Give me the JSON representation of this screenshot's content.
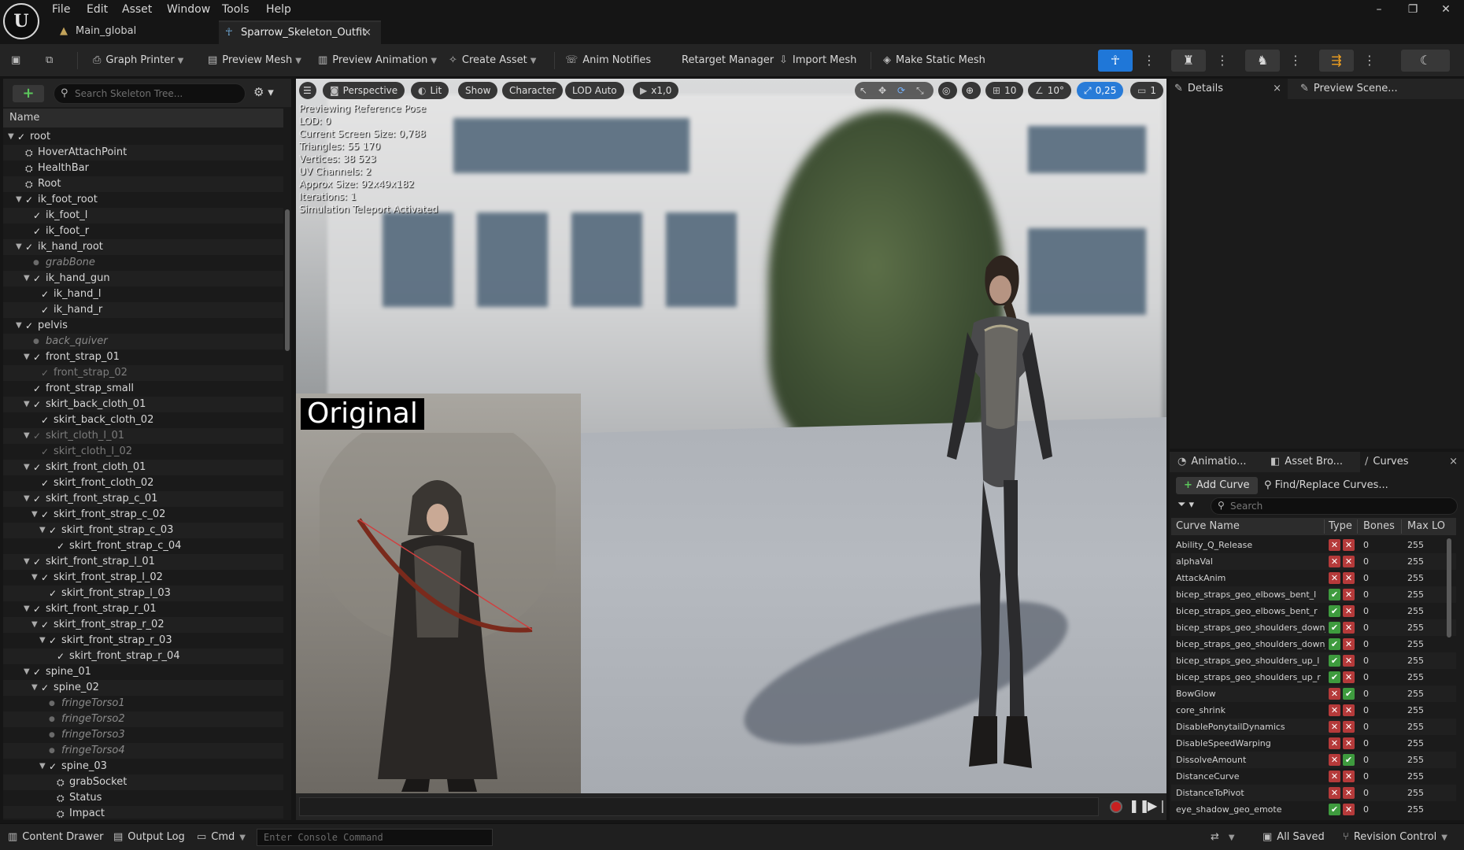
{
  "menu": [
    "File",
    "Edit",
    "Asset",
    "Window",
    "Tools",
    "Help"
  ],
  "tabs": [
    {
      "label": "Main_global"
    },
    {
      "label": "Sparrow_Skeleton_Outfit",
      "close": "×"
    }
  ],
  "window_controls": {
    "minimize": "–",
    "restore": "❐",
    "close": "✕"
  },
  "toolbar": {
    "graph_printer": "Graph Printer",
    "preview_mesh": "Preview Mesh",
    "preview_animation": "Preview Animation",
    "create_asset": "Create Asset",
    "anim_notifies": "Anim Notifies",
    "retarget_manager": "Retarget Manager",
    "import_mesh": "Import Mesh",
    "make_static_mesh": "Make Static Mesh"
  },
  "skeleton": {
    "search_placeholder": "Search Skeleton Tree...",
    "column": "Name",
    "bones": [
      {
        "name": "root",
        "indent": 0,
        "arrow": "▼",
        "icon": "bone"
      },
      {
        "name": "HoverAttachPoint",
        "indent": 1,
        "arrow": "",
        "icon": "socket"
      },
      {
        "name": "HealthBar",
        "indent": 1,
        "arrow": "",
        "icon": "socket"
      },
      {
        "name": "Root",
        "indent": 1,
        "arrow": "",
        "icon": "socket"
      },
      {
        "name": "ik_foot_root",
        "indent": 1,
        "arrow": "▼",
        "icon": "bone"
      },
      {
        "name": "ik_foot_l",
        "indent": 2,
        "arrow": "",
        "icon": "bone"
      },
      {
        "name": "ik_foot_r",
        "indent": 2,
        "arrow": "",
        "icon": "bone"
      },
      {
        "name": "ik_hand_root",
        "indent": 1,
        "arrow": "▼",
        "icon": "bone"
      },
      {
        "name": "grabBone",
        "indent": 2,
        "arrow": "",
        "icon": "dot",
        "style": "italic"
      },
      {
        "name": "ik_hand_gun",
        "indent": 2,
        "arrow": "▼",
        "icon": "bone"
      },
      {
        "name": "ik_hand_l",
        "indent": 3,
        "arrow": "",
        "icon": "bone"
      },
      {
        "name": "ik_hand_r",
        "indent": 3,
        "arrow": "",
        "icon": "bone"
      },
      {
        "name": "pelvis",
        "indent": 1,
        "arrow": "▼",
        "icon": "bone"
      },
      {
        "name": "back_quiver",
        "indent": 2,
        "arrow": "",
        "icon": "dot",
        "style": "italic"
      },
      {
        "name": "front_strap_01",
        "indent": 2,
        "arrow": "▼",
        "icon": "bone"
      },
      {
        "name": "front_strap_02",
        "indent": 3,
        "arrow": "",
        "icon": "faded",
        "style": "faded"
      },
      {
        "name": "front_strap_small",
        "indent": 2,
        "arrow": "",
        "icon": "bone"
      },
      {
        "name": "skirt_back_cloth_01",
        "indent": 2,
        "arrow": "▼",
        "icon": "bone"
      },
      {
        "name": "skirt_back_cloth_02",
        "indent": 3,
        "arrow": "",
        "icon": "bone"
      },
      {
        "name": "skirt_cloth_l_01",
        "indent": 2,
        "arrow": "▼",
        "icon": "faded",
        "style": "faded"
      },
      {
        "name": "skirt_cloth_l_02",
        "indent": 3,
        "arrow": "",
        "icon": "faded",
        "style": "faded"
      },
      {
        "name": "skirt_front_cloth_01",
        "indent": 2,
        "arrow": "▼",
        "icon": "bone"
      },
      {
        "name": "skirt_front_cloth_02",
        "indent": 3,
        "arrow": "",
        "icon": "bone"
      },
      {
        "name": "skirt_front_strap_c_01",
        "indent": 2,
        "arrow": "▼",
        "icon": "bone"
      },
      {
        "name": "skirt_front_strap_c_02",
        "indent": 3,
        "arrow": "▼",
        "icon": "bone"
      },
      {
        "name": "skirt_front_strap_c_03",
        "indent": 4,
        "arrow": "▼",
        "icon": "bone"
      },
      {
        "name": "skirt_front_strap_c_04",
        "indent": 5,
        "arrow": "",
        "icon": "bone"
      },
      {
        "name": "skirt_front_strap_l_01",
        "indent": 2,
        "arrow": "▼",
        "icon": "bone"
      },
      {
        "name": "skirt_front_strap_l_02",
        "indent": 3,
        "arrow": "▼",
        "icon": "bone"
      },
      {
        "name": "skirt_front_strap_l_03",
        "indent": 4,
        "arrow": "",
        "icon": "bone"
      },
      {
        "name": "skirt_front_strap_r_01",
        "indent": 2,
        "arrow": "▼",
        "icon": "bone"
      },
      {
        "name": "skirt_front_strap_r_02",
        "indent": 3,
        "arrow": "▼",
        "icon": "bone"
      },
      {
        "name": "skirt_front_strap_r_03",
        "indent": 4,
        "arrow": "▼",
        "icon": "bone"
      },
      {
        "name": "skirt_front_strap_r_04",
        "indent": 5,
        "arrow": "",
        "icon": "bone"
      },
      {
        "name": "spine_01",
        "indent": 2,
        "arrow": "▼",
        "icon": "bone"
      },
      {
        "name": "spine_02",
        "indent": 3,
        "arrow": "▼",
        "icon": "bone"
      },
      {
        "name": "fringeTorso1",
        "indent": 4,
        "arrow": "",
        "icon": "dot",
        "style": "italic"
      },
      {
        "name": "fringeTorso2",
        "indent": 4,
        "arrow": "",
        "icon": "dot",
        "style": "italic"
      },
      {
        "name": "fringeTorso3",
        "indent": 4,
        "arrow": "",
        "icon": "dot",
        "style": "italic"
      },
      {
        "name": "fringeTorso4",
        "indent": 4,
        "arrow": "",
        "icon": "dot",
        "style": "italic"
      },
      {
        "name": "spine_03",
        "indent": 4,
        "arrow": "▼",
        "icon": "bone"
      },
      {
        "name": "grabSocket",
        "indent": 5,
        "arrow": "",
        "icon": "socket"
      },
      {
        "name": "Status",
        "indent": 5,
        "arrow": "",
        "icon": "socket"
      },
      {
        "name": "Impact",
        "indent": 5,
        "arrow": "",
        "icon": "socket"
      }
    ]
  },
  "viewport": {
    "menu": "☰",
    "perspective": "Perspective",
    "lit": "Lit",
    "show": "Show",
    "character": "Character",
    "lod": "LOD Auto",
    "play_speed": "x1,0",
    "grid_size": "10",
    "rotation_snap": "10°",
    "scale_snap": "0,25",
    "camera_speed": "1",
    "stats": [
      "Previewing Reference Pose",
      "LOD: 0",
      "Current Screen Size: 0,788",
      "Triangles: 55 170",
      "Vertices: 38 523",
      "UV Channels: 2",
      "Approx Size: 92x49x182",
      "Iterations: 1",
      "Simulation Teleport Activated"
    ],
    "overlay_label": "Original"
  },
  "details": {
    "tab_details": "Details",
    "tab_close": "×",
    "tab_preview": "Preview Scene..."
  },
  "curves_panel": {
    "tab_anim": "Animatio...",
    "tab_asset": "Asset Bro...",
    "tab_curves": "Curves",
    "tab_close": "×",
    "add_curve": "Add Curve",
    "find_replace": "Find/Replace Curves...",
    "search_placeholder": "Search",
    "columns": [
      "Curve Name",
      "Type",
      "Bones",
      "Max LO"
    ],
    "rows": [
      {
        "name": "Ability_Q_Release",
        "t1": false,
        "t2": false,
        "bones": "0",
        "maxlod": "255"
      },
      {
        "name": "alphaVal",
        "t1": false,
        "t2": false,
        "bones": "0",
        "maxlod": "255"
      },
      {
        "name": "AttackAnim",
        "t1": false,
        "t2": false,
        "bones": "0",
        "maxlod": "255"
      },
      {
        "name": "bicep_straps_geo_elbows_bent_l",
        "t1": true,
        "t2": false,
        "bones": "0",
        "maxlod": "255"
      },
      {
        "name": "bicep_straps_geo_elbows_bent_r",
        "t1": true,
        "t2": false,
        "bones": "0",
        "maxlod": "255"
      },
      {
        "name": "bicep_straps_geo_shoulders_down_l",
        "t1": true,
        "t2": false,
        "bones": "0",
        "maxlod": "255"
      },
      {
        "name": "bicep_straps_geo_shoulders_down_r",
        "t1": true,
        "t2": false,
        "bones": "0",
        "maxlod": "255"
      },
      {
        "name": "bicep_straps_geo_shoulders_up_l",
        "t1": true,
        "t2": false,
        "bones": "0",
        "maxlod": "255"
      },
      {
        "name": "bicep_straps_geo_shoulders_up_r",
        "t1": true,
        "t2": false,
        "bones": "0",
        "maxlod": "255"
      },
      {
        "name": "BowGlow",
        "t1": false,
        "t2": true,
        "bones": "0",
        "maxlod": "255"
      },
      {
        "name": "core_shrink",
        "t1": false,
        "t2": false,
        "bones": "0",
        "maxlod": "255"
      },
      {
        "name": "DisablePonytailDynamics",
        "t1": false,
        "t2": false,
        "bones": "0",
        "maxlod": "255"
      },
      {
        "name": "DisableSpeedWarping",
        "t1": false,
        "t2": false,
        "bones": "0",
        "maxlod": "255"
      },
      {
        "name": "DissolveAmount",
        "t1": false,
        "t2": true,
        "bones": "0",
        "maxlod": "255"
      },
      {
        "name": "DistanceCurve",
        "t1": false,
        "t2": false,
        "bones": "0",
        "maxlod": "255"
      },
      {
        "name": "DistanceToPivot",
        "t1": false,
        "t2": false,
        "bones": "0",
        "maxlod": "255"
      },
      {
        "name": "eye_shadow_geo_emote",
        "t1": true,
        "t2": false,
        "bones": "0",
        "maxlod": "255"
      }
    ]
  },
  "statusbar": {
    "content_drawer": "Content Drawer",
    "output_log": "Output Log",
    "cmd": "Cmd",
    "console_placeholder": "Enter Console Command",
    "all_saved": "All Saved",
    "revision_control": "Revision Control"
  },
  "colors": {
    "accent": "#1f77d8",
    "type_on": "#3e9b3e",
    "type_off": "#b53a3a"
  },
  "icons": {
    "logo": "unreal-logo-icon"
  }
}
